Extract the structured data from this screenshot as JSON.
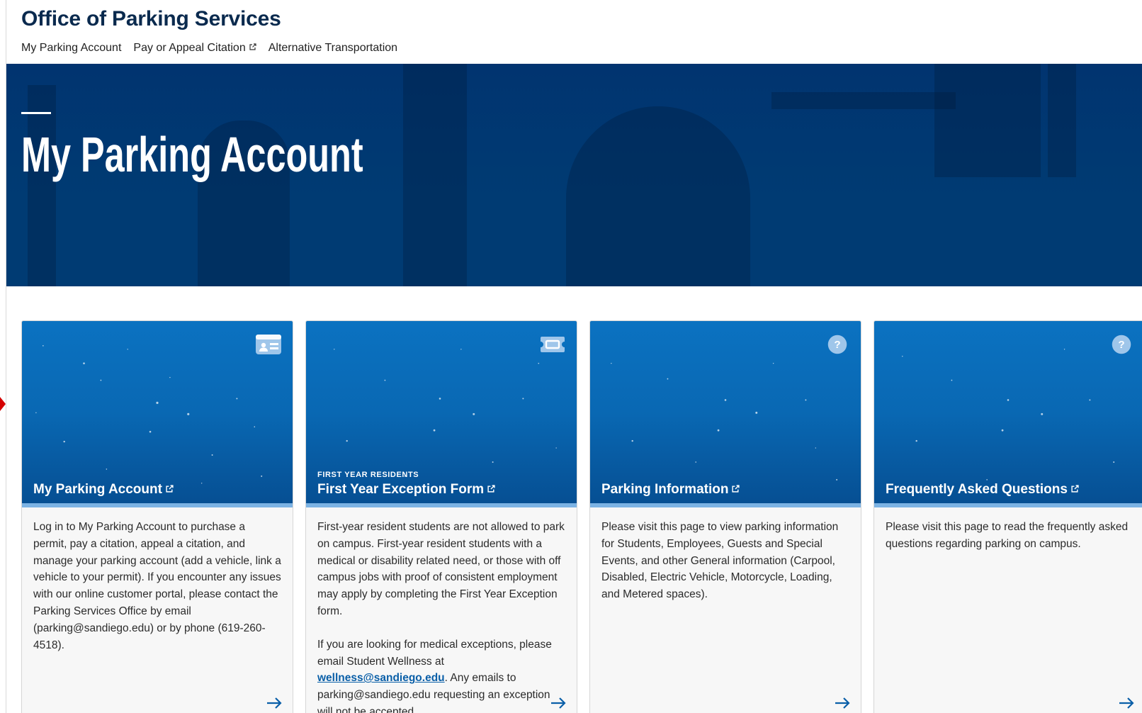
{
  "header": {
    "title": "Office of Parking Services",
    "nav": [
      {
        "label": "My Parking Account"
      },
      {
        "label": "Pay or Appeal Citation"
      },
      {
        "label": "Alternative Transportation"
      }
    ]
  },
  "hero": {
    "title": "My Parking Account"
  },
  "colors": {
    "navy": "#003b73",
    "card_blue": "#0968b3",
    "accent_light": "#7cb3e4",
    "link": "#0a5fa8"
  },
  "cards": [
    {
      "icon": "id-card-icon",
      "eyebrow": "",
      "title": "My Parking Account",
      "body": "Log in to My Parking Account to purchase a permit, pay a citation, appeal a citation, and manage your parking account (add a vehicle, link a vehicle to your permit). If you encounter any issues with our online customer portal, please contact the Parking Services Office by email (parking@sandiego.edu) or by phone (619-260-4518)."
    },
    {
      "icon": "ticket-icon",
      "eyebrow": "FIRST YEAR RESIDENTS",
      "title": "First Year Exception Form",
      "body": "First-year resident students are not allowed to park on campus. First-year resident students with a medical or disability related need, or those with off campus jobs with proof of consistent employment may apply by completing the First Year Exception form.",
      "body2_before": "If you are looking for medical exceptions, please email Student Wellness at ",
      "body2_link": "wellness@sandiego.edu",
      "body2_after": ". Any emails to parking@sandiego.edu requesting an exception will not be accepted."
    },
    {
      "icon": "question-circle-icon",
      "eyebrow": "",
      "title": "Parking Information",
      "body": "Please visit this page to view parking information for Students, Employees, Guests and Special Events, and other General information (Carpool, Disabled, Electric Vehicle, Motorcycle, Loading, and Metered spaces)."
    },
    {
      "icon": "question-circle-icon",
      "eyebrow": "",
      "title": "Frequently Asked Questions",
      "body": "Please visit this page to read the frequently asked questions regarding parking on campus."
    }
  ]
}
